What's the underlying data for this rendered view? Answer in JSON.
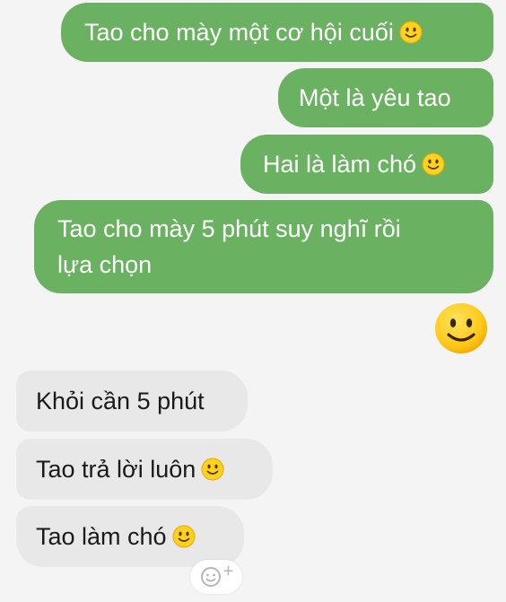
{
  "conversation": {
    "sent_messages": [
      {
        "text": "Tao cho mày một cơ hội cuối",
        "emoji": "slightly-smiling-face"
      },
      {
        "text": "Một là yêu tao",
        "emoji": ""
      },
      {
        "text": "Hai là làm chó",
        "emoji": "slightly-smiling-face"
      },
      {
        "line1": "Tao cho mày 5 phút suy nghĩ rồi",
        "line2": "lựa chọn"
      }
    ],
    "sent_sticker": "large-smiling-face",
    "received_messages": [
      {
        "text": "Khỏi cần 5 phút",
        "emoji": ""
      },
      {
        "text": "Tao trả lời luôn",
        "emoji": "slightly-smiling-face"
      },
      {
        "text": "Tao làm chó",
        "emoji": "slightly-smiling-face"
      }
    ],
    "reaction_button": {
      "icon": "add-reaction-icon",
      "symbol": "+"
    }
  },
  "colors": {
    "sent_bubble": "#6ab161",
    "received_bubble": "#e8e8e8",
    "background": "#f4f4f4",
    "smiley_face": "#ffd21f"
  }
}
